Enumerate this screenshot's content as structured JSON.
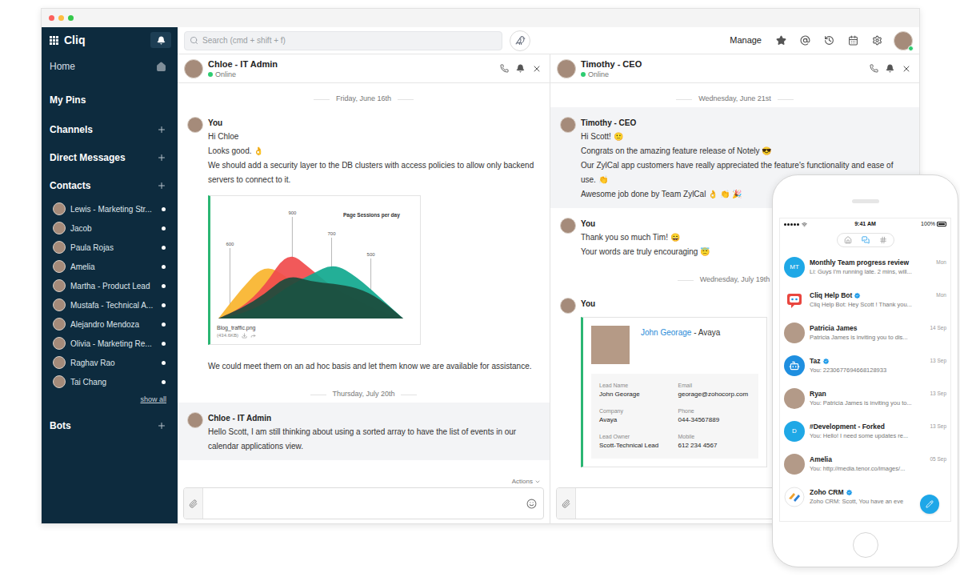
{
  "sidebar": {
    "app_name": "Cliq",
    "nav": [
      {
        "label": "Home",
        "kind": "home"
      },
      {
        "label": "My Pins",
        "kind": "link"
      },
      {
        "label": "Channels",
        "kind": "group"
      },
      {
        "label": "Direct Messages",
        "kind": "group"
      },
      {
        "label": "Contacts",
        "kind": "group"
      }
    ],
    "contacts": [
      {
        "name": "Lewis - Marketing Str...",
        "online": true
      },
      {
        "name": "Jacob",
        "online": true
      },
      {
        "name": "Paula Rojas",
        "online": true
      },
      {
        "name": "Amelia",
        "online": true
      },
      {
        "name": "Martha - Product Lead",
        "online": true
      },
      {
        "name": "Mustafa - Technical A...",
        "online": true
      },
      {
        "name": "Alejandro Mendoza",
        "online": true
      },
      {
        "name": "Olivia - Marketing Re...",
        "online": true
      },
      {
        "name": "Raghav Rao",
        "online": true
      },
      {
        "name": "Tai Chang",
        "online": true
      }
    ],
    "show_all": "show all",
    "bots_label": "Bots"
  },
  "toolbar": {
    "search_placeholder": "Search (cmd + shift + f)",
    "manage": "Manage",
    "user_online": true
  },
  "chats": [
    {
      "title": "Chloe - IT Admin",
      "status": "Online",
      "online": true,
      "actions": "Actions",
      "items": [
        {
          "kind": "date",
          "text": "Friday, June 16th"
        },
        {
          "kind": "message",
          "sender": "You",
          "highlighted": false,
          "parts": [
            {
              "kind": "text",
              "text": "Hi Chloe"
            },
            {
              "kind": "text",
              "text": "Looks good. 👌"
            },
            {
              "kind": "text",
              "text": "We should add a security layer to the DB clusters with access policies to allow only backend servers to connect to it."
            },
            {
              "kind": "chart",
              "title": "Page Sessions per day",
              "file": "Blog_traffic.png",
              "size": "(434.6KB)",
              "series": [
                {
                  "color": "#f9b42d",
                  "values": [
                    0,
                    260,
                    470,
                    360,
                    180,
                    120,
                    80,
                    40,
                    0
                  ]
                },
                {
                  "color": "#f04b4c",
                  "values": [
                    0,
                    90,
                    280,
                    590,
                    430,
                    260,
                    160,
                    60,
                    0
                  ]
                },
                {
                  "color": "#10a88e",
                  "values": [
                    0,
                    40,
                    130,
                    280,
                    380,
                    480,
                    360,
                    180,
                    0
                  ]
                },
                {
                  "color": "#1c4b3c",
                  "values": [
                    0,
                    90,
                    210,
                    380,
                    320,
                    300,
                    270,
                    170,
                    0
                  ]
                }
              ],
              "callouts": [
                {
                  "label": "600",
                  "value": 600,
                  "index": 0.5
                },
                {
                  "label": "900",
                  "value": 900,
                  "index": 3.2
                },
                {
                  "label": "700",
                  "value": 700,
                  "index": 4.9
                },
                {
                  "label": "500",
                  "value": 500,
                  "index": 6.6
                }
              ]
            },
            {
              "kind": "text",
              "text": "We could meet them on an ad hoc basis and let them know we are available for assistance."
            }
          ]
        },
        {
          "kind": "date",
          "text": "Thursday, July 20th"
        },
        {
          "kind": "message",
          "sender": "Chloe - IT Admin",
          "highlighted": true,
          "parts": [
            {
              "kind": "text",
              "text": "Hello Scott, I am still thinking about using a sorted array to have the list of events in our calendar applications view."
            }
          ]
        }
      ]
    },
    {
      "title": "Timothy - CEO",
      "status": "Online",
      "online": true,
      "items": [
        {
          "kind": "date",
          "text": "Wednesday, June 21st"
        },
        {
          "kind": "message",
          "sender": "Timothy - CEO",
          "highlighted": true,
          "parts": [
            {
              "kind": "text",
              "text": "Hi Scott! 🙂"
            },
            {
              "kind": "text",
              "text": "Congrats on the amazing feature release of Notely 😎"
            },
            {
              "kind": "text",
              "text": "Our ZylCal app customers have really appreciated the feature's functionality and ease of use. 👏"
            },
            {
              "kind": "text",
              "text": "Awesome job done by Team ZylCal 👌 👏 🎉"
            }
          ]
        },
        {
          "kind": "message",
          "sender": "You",
          "highlighted": false,
          "parts": [
            {
              "kind": "text",
              "text": "Thank you so much Tim! 😄"
            },
            {
              "kind": "text",
              "text": "Your words are truly encouraging 😇"
            }
          ]
        },
        {
          "kind": "date",
          "text": "Wednesday, July 19th"
        },
        {
          "kind": "message",
          "sender": "You",
          "highlighted": false,
          "parts": [
            {
              "kind": "card",
              "title_link": "John Georage",
              "title_rest": "- Avaya",
              "fields": [
                {
                  "label": "Lead Name",
                  "value": "John Georage"
                },
                {
                  "label": "Email",
                  "value": "georage@zohocorp.com"
                },
                {
                  "label": "Company",
                  "value": "Avaya"
                },
                {
                  "label": "Phone",
                  "value": "044-34567889"
                },
                {
                  "label": "Lead Owner",
                  "value": "Scott-Technical Lead"
                },
                {
                  "label": "Mobile",
                  "value": "612 234 4567"
                }
              ]
            }
          ]
        }
      ]
    }
  ],
  "phone": {
    "time": "9:41 AM",
    "battery": "100%",
    "tabs": [
      {
        "kind": "home",
        "selected": false
      },
      {
        "kind": "chats",
        "selected": true
      },
      {
        "kind": "channels",
        "selected": false
      }
    ],
    "conversations": [
      {
        "title": "Monthly Team progress review",
        "preview": "Li: Guys I'm running late. 2 mins, will...",
        "date": "Mon",
        "verified": false,
        "avatar": "initials",
        "initials": "MT"
      },
      {
        "title": "Cliq Help Bot",
        "preview": "Cliq Help Bot: Hey Scott ! Thank you...",
        "date": "Mon",
        "verified": true,
        "avatar": "cliq-bot"
      },
      {
        "title": "Patricia James",
        "preview": "Patricia James is inviting you to dis...",
        "date": "14 Sep",
        "verified": false,
        "avatar": "photo"
      },
      {
        "title": "Taz",
        "preview": "You: 2230677694668128933",
        "date": "13 Sep",
        "verified": true,
        "avatar": "taz"
      },
      {
        "title": "Ryan",
        "preview": "You: Patricia James is inviting you to...",
        "date": "13 Sep",
        "verified": false,
        "avatar": "photo"
      },
      {
        "title": "#Development - Forked",
        "preview": "You: Hello! I need some updates re...",
        "date": "13 Sep",
        "verified": false,
        "avatar": "initials",
        "initials": "D"
      },
      {
        "title": "Amelia",
        "preview": "You: http://media.tenor.co/images/...",
        "date": "05 Sep",
        "verified": false,
        "avatar": "photo"
      },
      {
        "title": "Zoho CRM",
        "preview": "Zoho CRM: Scott, You have an eve",
        "verified": true,
        "avatar": "crm"
      }
    ]
  }
}
